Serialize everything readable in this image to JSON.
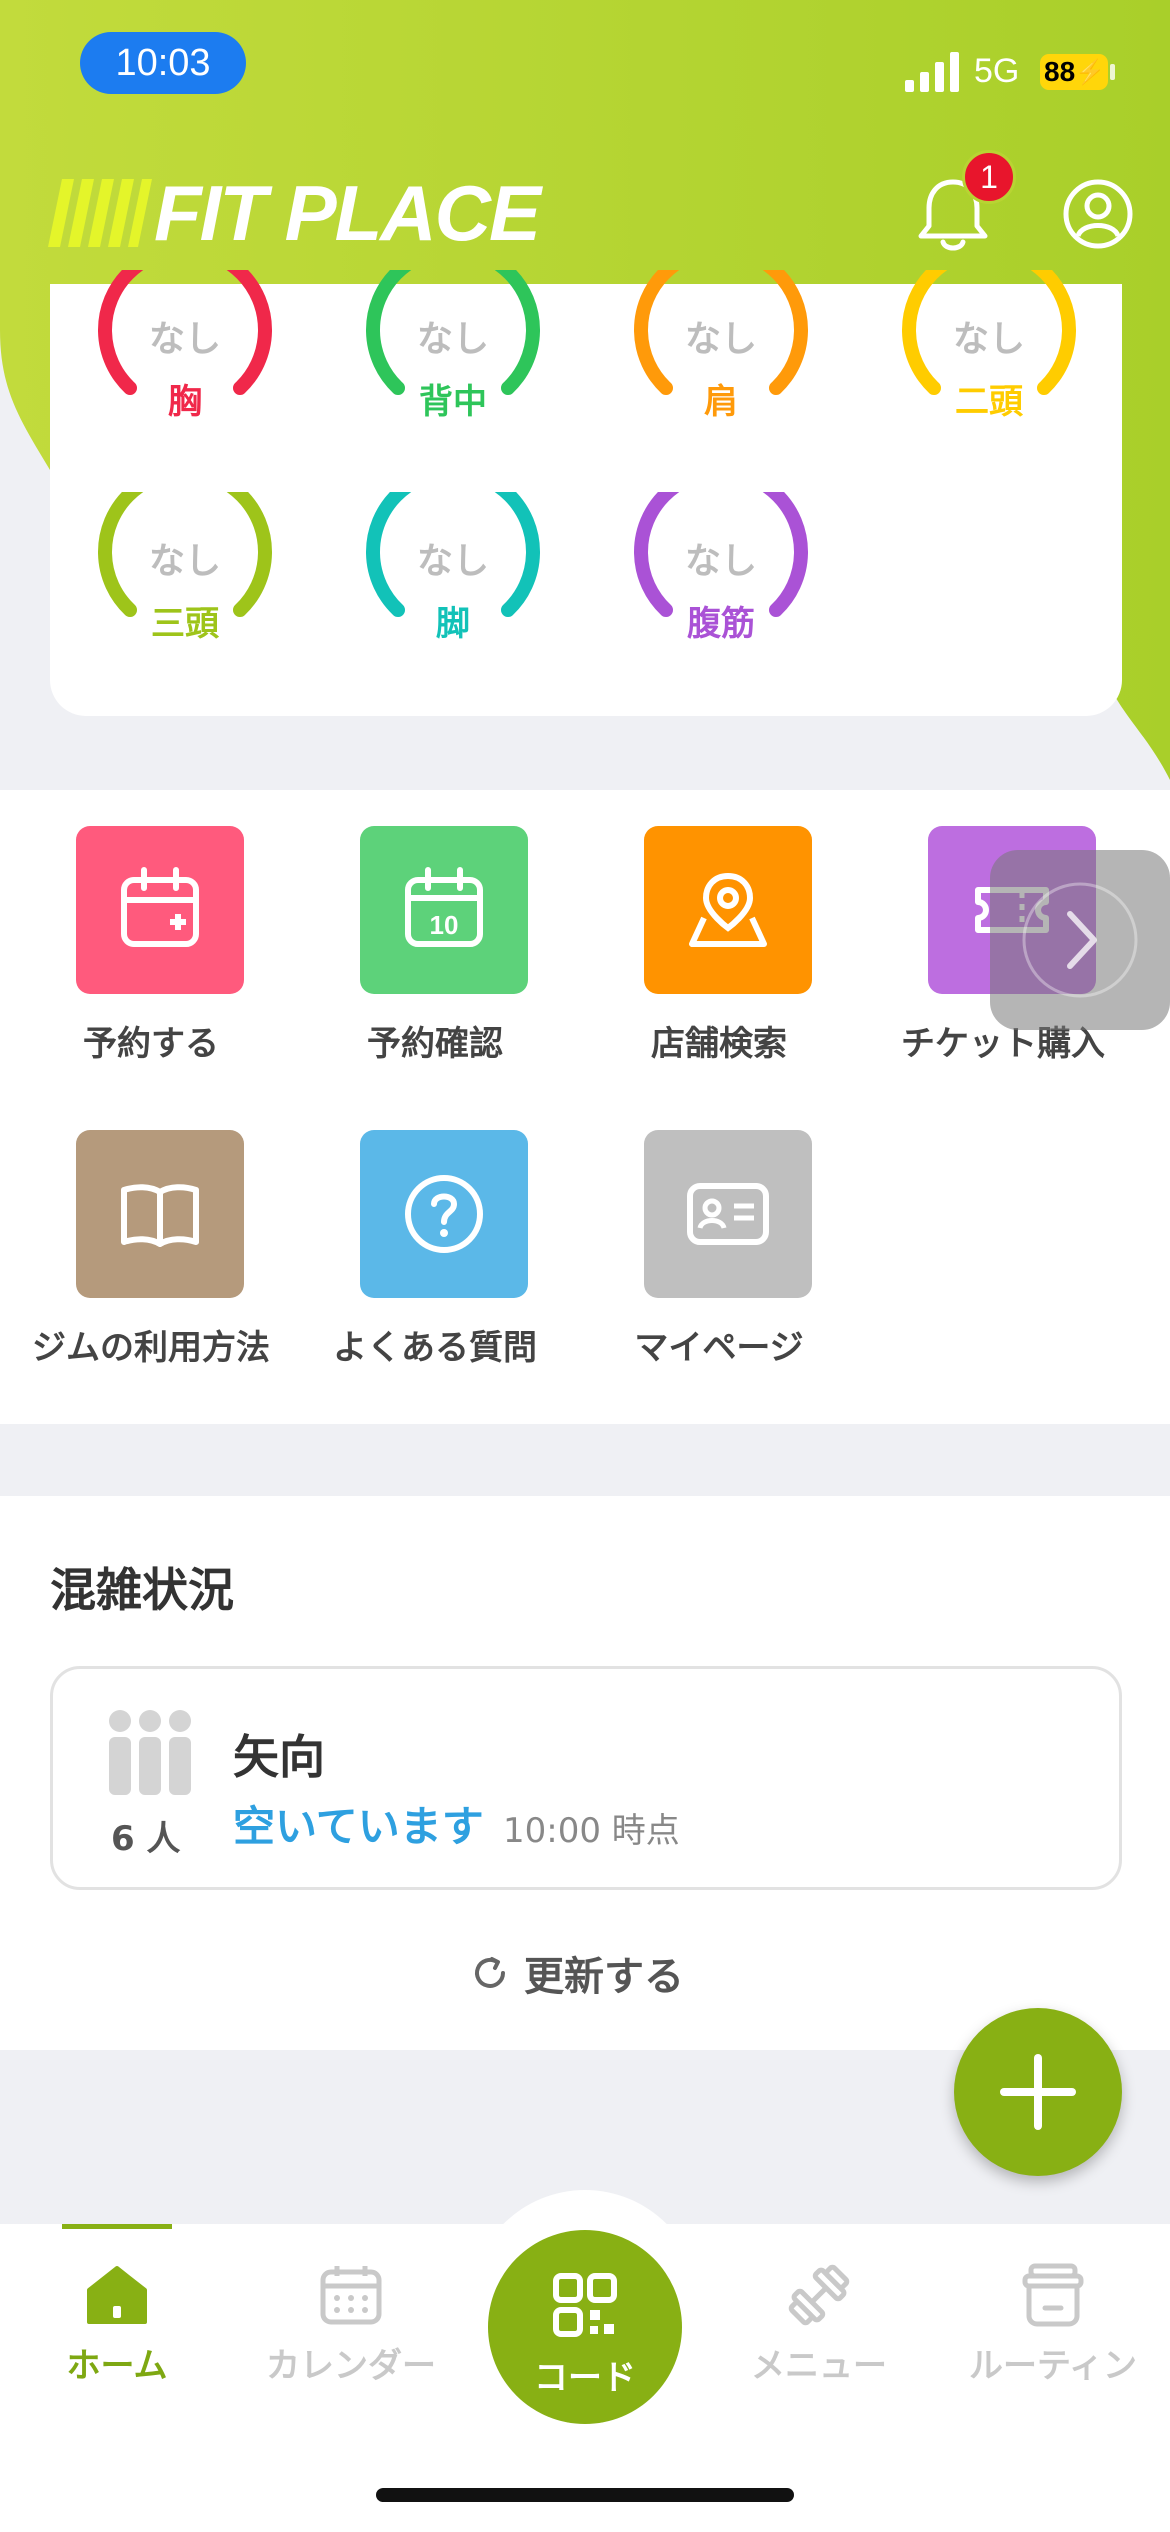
{
  "status_bar": {
    "time": "10:03",
    "network": "5G",
    "battery": "88"
  },
  "header": {
    "logo_text": "FIT PLACE",
    "notification_count": "1"
  },
  "muscles": [
    {
      "value": "なし",
      "label": "胸",
      "color": "#f0284a"
    },
    {
      "value": "なし",
      "label": "背中",
      "color": "#2ec55a"
    },
    {
      "value": "なし",
      "label": "肩",
      "color": "#ff9a0a"
    },
    {
      "value": "なし",
      "label": "二頭",
      "color": "#ffcc00"
    },
    {
      "value": "なし",
      "label": "三頭",
      "color": "#9ec41a"
    },
    {
      "value": "なし",
      "label": "脚",
      "color": "#12c2b8"
    },
    {
      "value": "なし",
      "label": "腹筋",
      "color": "#aa52d6"
    }
  ],
  "menu": [
    {
      "label": "予約する",
      "icon": "calendar-plus-icon",
      "color": "#ff5a7d"
    },
    {
      "label": "予約確認",
      "icon": "calendar-check-icon",
      "color": "#5dd27a",
      "day": "10"
    },
    {
      "label": "店舗検索",
      "icon": "map-pin-icon",
      "color": "#ff9300"
    },
    {
      "label": "チケット購入",
      "icon": "ticket-icon",
      "color": "#bd6ee0"
    },
    {
      "label": "ジムの利用方法",
      "icon": "book-icon",
      "color": "#b59a7c"
    },
    {
      "label": "よくある質問",
      "icon": "question-icon",
      "color": "#5bb8e8"
    },
    {
      "label": "マイページ",
      "icon": "id-card-icon",
      "color": "#bfbfbf"
    }
  ],
  "crowd": {
    "title": "混雑状況",
    "count": "6 人",
    "store": "矢向",
    "status": "空いています",
    "as_of": "10:00 時点",
    "refresh_label": "更新する"
  },
  "nav": {
    "home": "ホーム",
    "calendar": "カレンダー",
    "code": "コード",
    "menu": "メニュー",
    "routine": "ルーティン"
  },
  "colors": {
    "accent": "#88b014",
    "header": "#b8d433"
  }
}
